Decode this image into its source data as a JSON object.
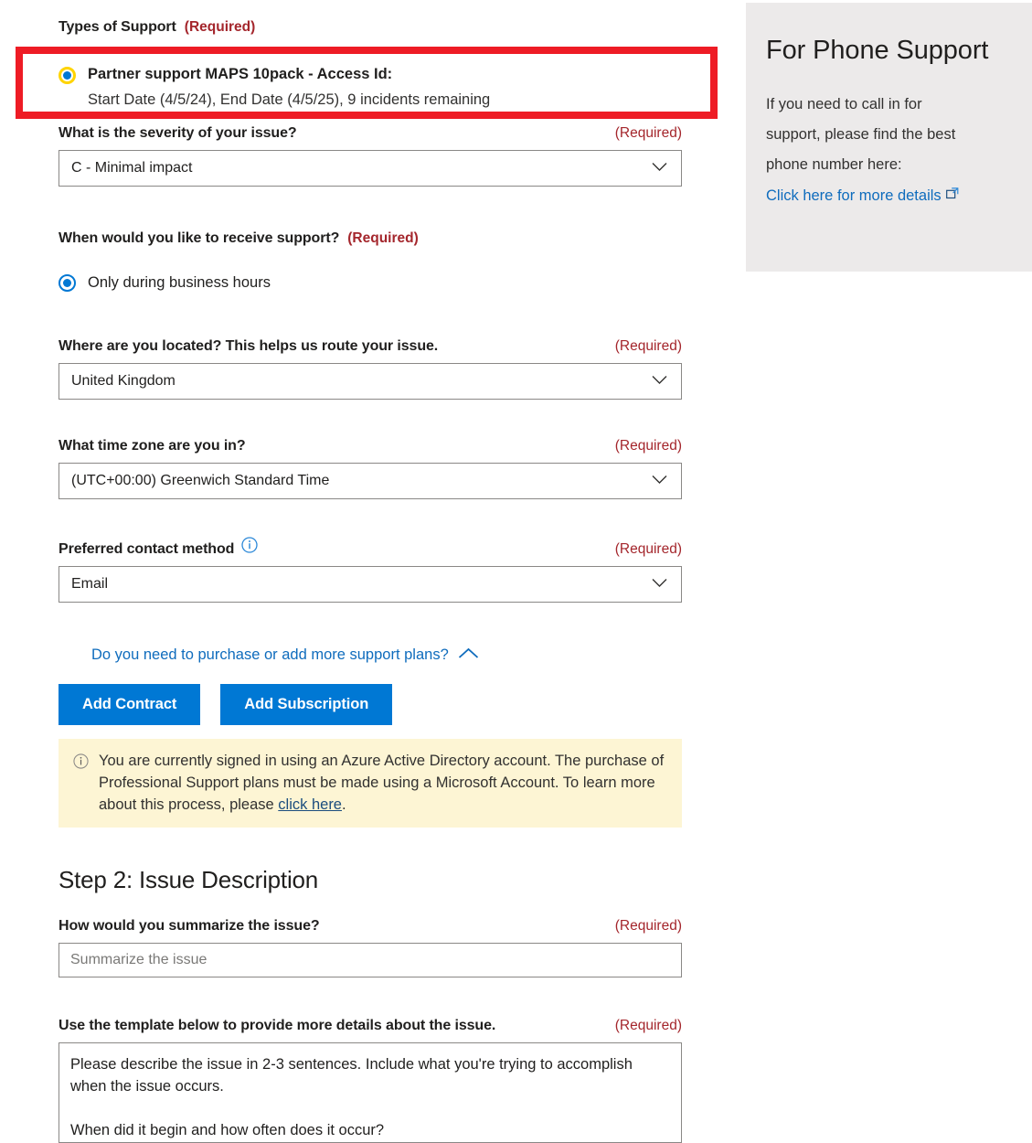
{
  "form": {
    "types_of_support": {
      "label": "Types of Support",
      "required": "(Required)",
      "plan_title": "Partner support MAPS 10pack - Access Id:",
      "plan_details": "Start Date (4/5/24), End Date (4/5/25), 9 incidents remaining"
    },
    "severity": {
      "label": "What is the severity of your issue?",
      "required": "(Required)",
      "value": "C - Minimal impact"
    },
    "receive_support": {
      "label": "When would you like to receive support?",
      "required": "(Required)",
      "option_label": "Only during business hours"
    },
    "location": {
      "label": "Where are you located? This helps us route your issue.",
      "required": "(Required)",
      "value": "United Kingdom"
    },
    "timezone": {
      "label": "What time zone are you in?",
      "required": "(Required)",
      "value": "(UTC+00:00) Greenwich Standard Time"
    },
    "contact_method": {
      "label": "Preferred contact method",
      "required": "(Required)",
      "value": "Email"
    },
    "expander": {
      "label": "Do you need to purchase or add more support plans?"
    },
    "buttons": {
      "add_contract": "Add Contract",
      "add_subscription": "Add Subscription"
    },
    "notice": {
      "text_before": "You are currently signed in using an Azure Active Directory account. The purchase of Professional Support plans must be made using a Microsoft Account. To learn more about this process, please ",
      "link": "click here",
      "text_after": "."
    }
  },
  "step2": {
    "title": "Step 2: Issue Description",
    "summary": {
      "label": "How would you summarize the issue?",
      "required": "(Required)",
      "placeholder": "Summarize the issue",
      "value": ""
    },
    "details": {
      "label": "Use the template below to provide more details about the issue.",
      "required": "(Required)",
      "value": "Please describe the issue in 2-3 sentences. Include what you're trying to accomplish when the issue occurs.\n\nWhen did it begin and how often does it occur?"
    }
  },
  "sidebar": {
    "title": "For Phone Support",
    "body_line1": "If you need to call in for",
    "body_line2": "support, please find the best",
    "body_line3": "phone number here:",
    "link": "Click here for more details"
  },
  "colors": {
    "accent_blue": "#0078d4",
    "link_blue": "#0f6cbd",
    "required_red": "#a4262c",
    "highlight_red": "#ee1c25",
    "notice_yellow": "#fdf5d4",
    "panel_grey": "#eceaea",
    "radio_ring_yellow": "#ffd400"
  }
}
